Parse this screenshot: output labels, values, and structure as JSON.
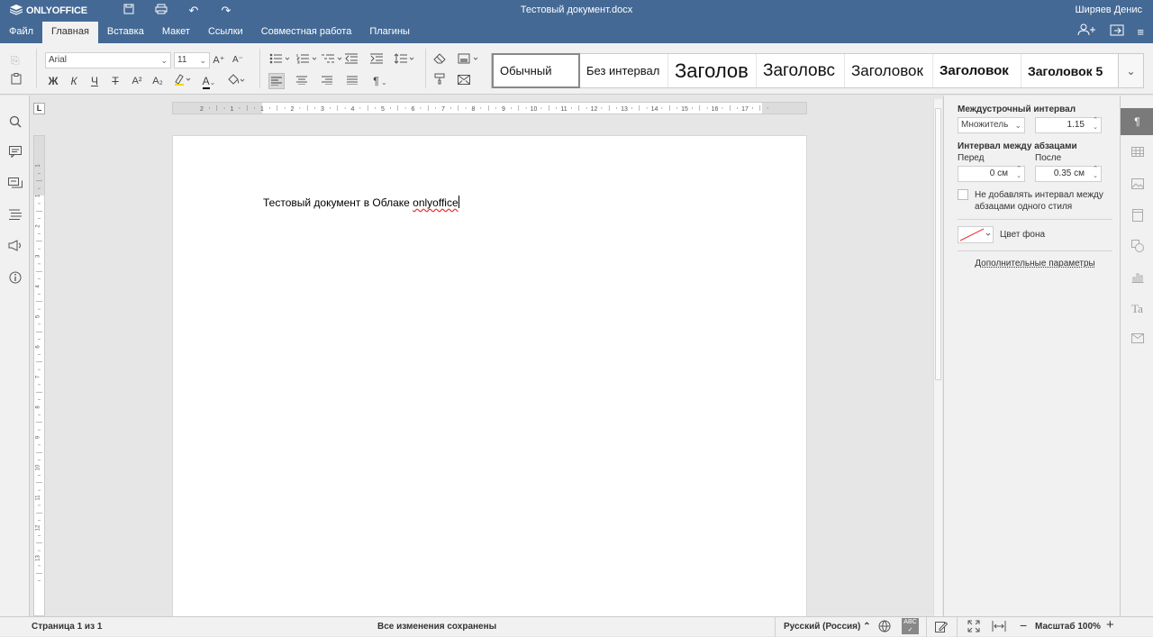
{
  "app": {
    "logo": "ONLYOFFICE",
    "document_title": "Тестовый документ.docx",
    "user_name": "Ширяев Денис"
  },
  "menu": {
    "tabs": [
      {
        "label": "Файл"
      },
      {
        "label": "Главная"
      },
      {
        "label": "Вставка"
      },
      {
        "label": "Макет"
      },
      {
        "label": "Ссылки"
      },
      {
        "label": "Совместная работа"
      },
      {
        "label": "Плагины"
      }
    ]
  },
  "toolbar": {
    "font_name": "Arial",
    "font_size": "11",
    "bold_label": "Ж",
    "italic_label": "К",
    "underline_label": "Ч",
    "strike_label": "Т",
    "superscript_label": "A²",
    "subscript_label": "A₂",
    "font_color_label": "A",
    "increase_font_label": "A⁺",
    "decrease_font_label": "A⁻",
    "pilcrow_label": "¶"
  },
  "styles": [
    {
      "label": "Обычный"
    },
    {
      "label": "Без интервал"
    },
    {
      "label": "Заголов"
    },
    {
      "label": "Заголовс"
    },
    {
      "label": "Заголовок"
    },
    {
      "label": "Заголовок"
    },
    {
      "label": "Заголовок 5"
    }
  ],
  "ruler": {
    "h_ticks": [
      "2",
      "1",
      "1",
      "2",
      "3",
      "4",
      "5",
      "6",
      "7",
      "8",
      "9",
      "10",
      "11",
      "12",
      "13",
      "14",
      "15",
      "16",
      "17"
    ],
    "v_ticks": [
      "1",
      "1",
      "2",
      "3",
      "4",
      "5",
      "6",
      "7",
      "8",
      "9",
      "10",
      "11",
      "12",
      "13"
    ],
    "corner_label": "L"
  },
  "document": {
    "text_before": "Тестовый документ в Облаке ",
    "text_misspelled": "onlyoffice"
  },
  "paragraph_settings": {
    "line_spacing_title": "Междустрочный интервал",
    "line_spacing_mode": "Множитель",
    "line_spacing_value": "1.15",
    "para_spacing_title": "Интервал между абзацами",
    "before_label": "Перед",
    "before_value": "0 см",
    "after_label": "После",
    "after_value": "0.35 см",
    "no_spacing_label_1": "Не добавлять интервал между",
    "no_spacing_label_2": "абзацами одного стиля",
    "background_color_label": "Цвет фона",
    "advanced_label": "Дополнительные параметры"
  },
  "statusbar": {
    "page_info": "Страница 1 из 1",
    "save_status": "Все изменения сохранены",
    "language": "Русский (Россия)",
    "zoom_label": "Масштаб 100%"
  },
  "colors": {
    "header_bg": "#446995",
    "toolbar_bg": "#f1f1f1",
    "spell_error": "#e33333"
  }
}
